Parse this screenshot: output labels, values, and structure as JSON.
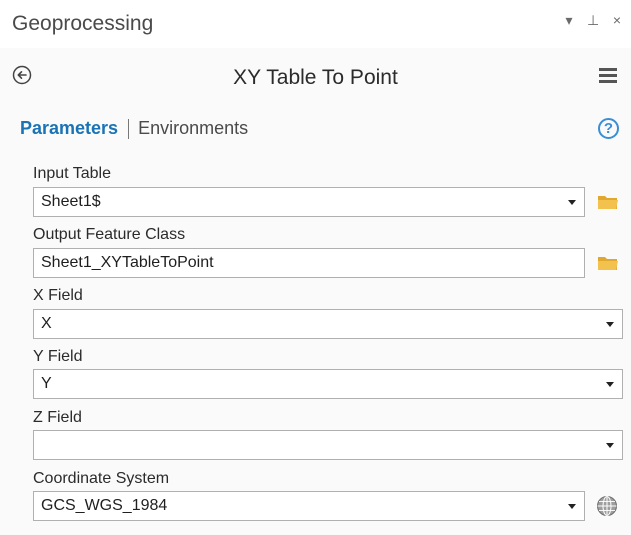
{
  "window": {
    "title": "Geoprocessing",
    "controls": {
      "dropdown": "▾",
      "pin": "⊥",
      "close": "×"
    }
  },
  "tool": {
    "title": "XY Table To Point",
    "back_icon": "back-arrow-icon",
    "menu_icon": "hamburger-menu-icon"
  },
  "tabs": {
    "parameters": "Parameters",
    "environments": "Environments",
    "help": "?"
  },
  "parameters": {
    "input_table": {
      "label": "Input Table",
      "value": "Sheet1$"
    },
    "output_feature_class": {
      "label": "Output Feature Class",
      "value": "Sheet1_XYTableToPoint"
    },
    "x_field": {
      "label": "X Field",
      "value": "X"
    },
    "y_field": {
      "label": "Y Field",
      "value": "Y"
    },
    "z_field": {
      "label": "Z Field",
      "value": ""
    },
    "coordinate_system": {
      "label": "Coordinate System",
      "value": "GCS_WGS_1984"
    }
  },
  "colors": {
    "accent": "#1a73b5",
    "folder": "#f2c14e",
    "help": "#3a8fd4"
  }
}
